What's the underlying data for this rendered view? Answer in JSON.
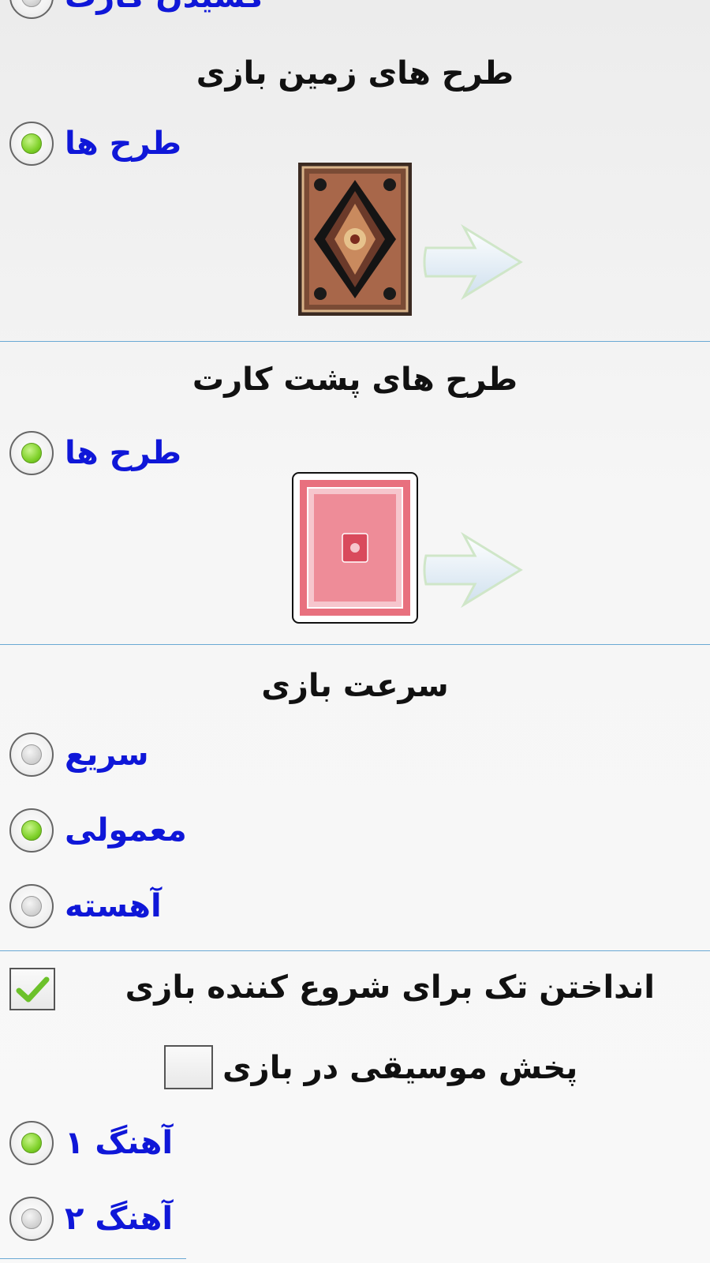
{
  "top_partial_option": {
    "label": "کشیدن کارت",
    "selected": false
  },
  "table_designs": {
    "title": "طرح های زمین بازی",
    "option": {
      "label": "طرح ها",
      "selected": true
    },
    "preview_icon": "persian-carpet-pattern",
    "next_icon": "next-arrow-icon"
  },
  "card_back_designs": {
    "title": "طرح های پشت کارت",
    "option": {
      "label": "طرح ها",
      "selected": true
    },
    "preview_icon": "red-card-back-pattern",
    "next_icon": "next-arrow-icon"
  },
  "game_speed": {
    "title": "سرعت بازی",
    "options": [
      {
        "label": "سریع",
        "selected": false
      },
      {
        "label": "معمولی",
        "selected": true
      },
      {
        "label": "آهسته",
        "selected": false
      }
    ]
  },
  "starter_single_card": {
    "label": "انداختن تک برای شروع کننده بازی",
    "checked": true
  },
  "music": {
    "label": "پخش موسیقی در بازی",
    "checked": false,
    "options": [
      {
        "label": "آهنگ ۱",
        "selected": true
      },
      {
        "label": "آهنگ ۲",
        "selected": false
      }
    ]
  },
  "colors": {
    "accent_blue": "#0f17d8",
    "divider": "#6aa9d4",
    "radio_on": "#7fd12a",
    "check_green": "#6cc12a"
  }
}
